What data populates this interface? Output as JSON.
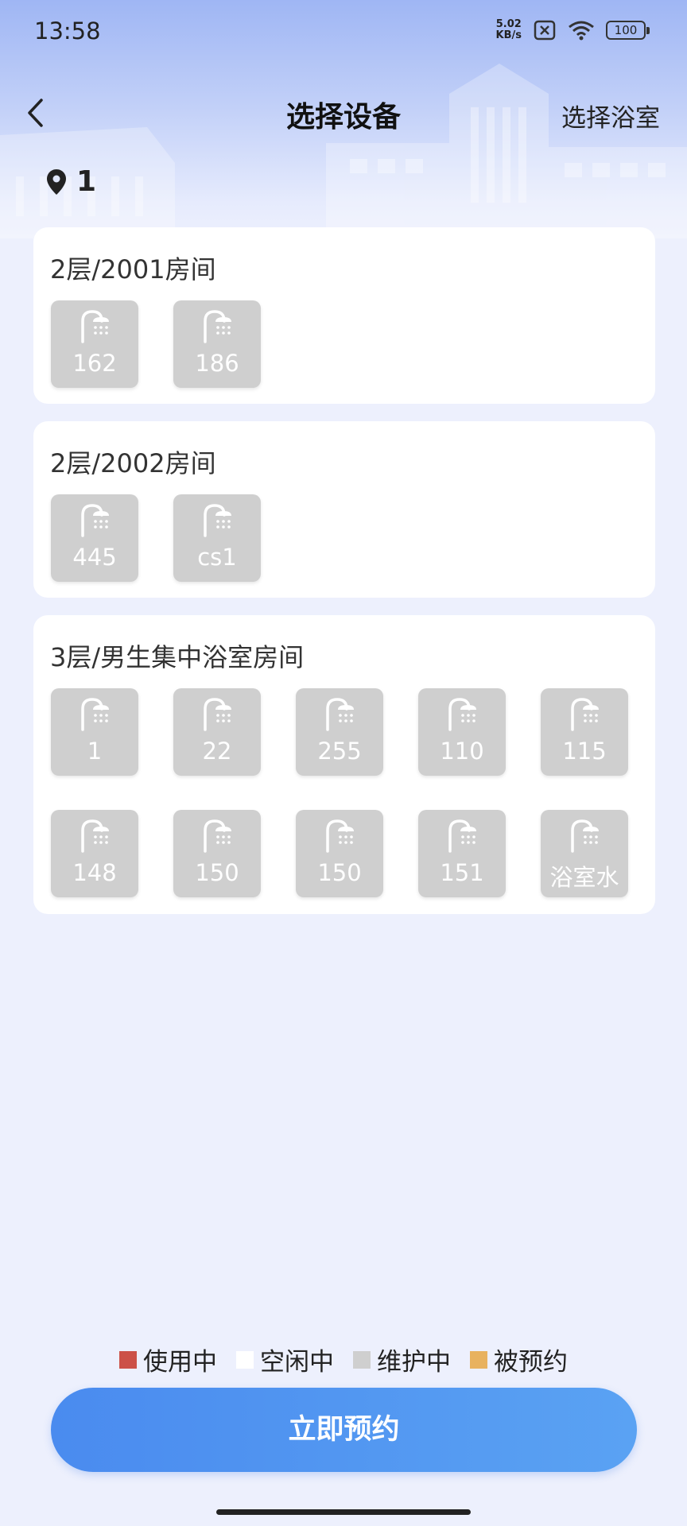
{
  "status": {
    "time": "13:58",
    "net_speed_value": "5.02",
    "net_speed_unit": "KB/s",
    "battery": "100"
  },
  "header": {
    "title": "选择设备",
    "right_action": "选择浴室",
    "location": "1"
  },
  "rooms": [
    {
      "title": "2层/2001房间",
      "devices": [
        "162",
        "186"
      ]
    },
    {
      "title": "2层/2002房间",
      "devices": [
        "445",
        "cs1"
      ]
    },
    {
      "title": "3层/男生集中浴室房间",
      "devices": [
        "1",
        "22",
        "255",
        "110",
        "115",
        "148",
        "150",
        "150",
        "151",
        "浴室水"
      ]
    }
  ],
  "legend": [
    {
      "label": "使用中",
      "color": "#cc5147"
    },
    {
      "label": "空闲中",
      "color": "#ffffff"
    },
    {
      "label": "维护中",
      "color": "#cfcfcf"
    },
    {
      "label": "被预约",
      "color": "#e8b25e"
    }
  ],
  "device_status_color": "#cfcfcf",
  "icons": {
    "back": "chevron-left-icon",
    "location": "map-pin-icon",
    "device": "shower-icon"
  },
  "action_button": "立即预约"
}
